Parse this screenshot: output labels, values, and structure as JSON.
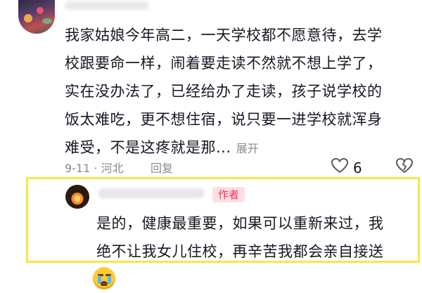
{
  "comment": {
    "lines": [
      "我家姑娘今年高二，一天学校都不愿意待，去学",
      "校跟要命一样，闹着要走读不然就不想上学了，",
      "实在没办法了，已经给办了走读，孩子说学校的",
      "饭太难吃，更不想住宿，说只要一进学校就浑身",
      "难受，不是这疼就是那..."
    ],
    "expand_label": "展开",
    "date_location": "9-11 · 河北",
    "reply_label": "回复",
    "like_count": "6"
  },
  "author_reply": {
    "badge": "作者",
    "lines": [
      "是的，健康最重要，如果可以重新来过，我",
      "绝不让我女儿住校，再辛苦我都会亲自接送"
    ],
    "emoji": "crying-emoji"
  },
  "colors": {
    "highlight_border": "#f2ea44",
    "author_badge_bg": "#fde0e4",
    "author_badge_text": "#fe2c55",
    "meta_text": "#8a8b91"
  }
}
